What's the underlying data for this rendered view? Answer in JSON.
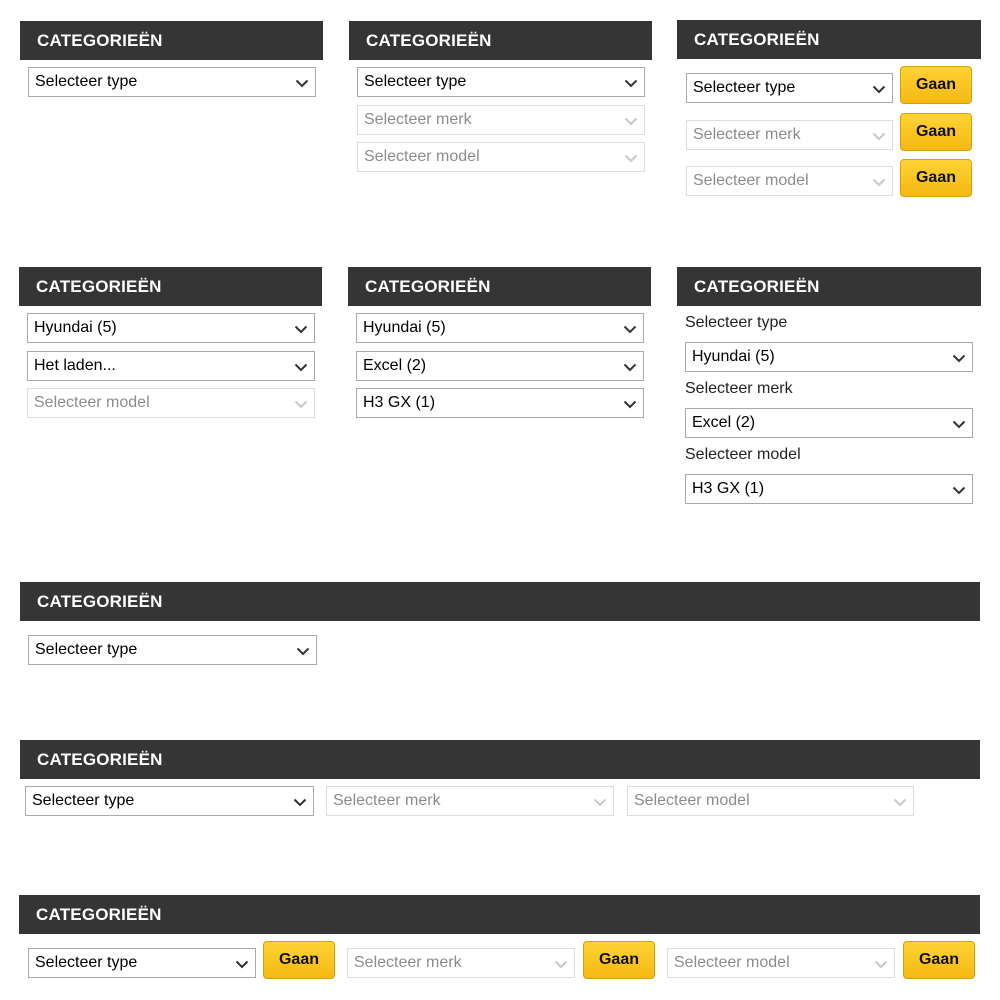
{
  "colors": {
    "header_bg": "#353535",
    "header_text": "#ffffff",
    "button_bg": "#f8c21c",
    "select_border": "#a9a9a9",
    "disabled_text": "#8c8c8c"
  },
  "icons": {
    "select_arrow": "chevron-down-icon"
  },
  "widgets": {
    "w1": {
      "header": "CATEGORIEËN",
      "type": "Selecteer type"
    },
    "w2": {
      "header": "CATEGORIEËN",
      "type": "Selecteer type",
      "merk": "Selecteer merk",
      "model": "Selecteer model"
    },
    "w3": {
      "header": "CATEGORIEËN",
      "type": "Selecteer type",
      "merk": "Selecteer merk",
      "model": "Selecteer model",
      "button": "Gaan"
    },
    "w4": {
      "header": "CATEGORIEËN",
      "type": "Hyundai (5)",
      "merk": "Het laden...",
      "model": "Selecteer model"
    },
    "w5": {
      "header": "CATEGORIEËN",
      "type": "Hyundai (5)",
      "merk": "Excel (2)",
      "model": "H3 GX (1)"
    },
    "w6": {
      "header": "CATEGORIEËN",
      "type_label": "Selecteer type",
      "type": "Hyundai (5)",
      "merk_label": "Selecteer merk",
      "merk": "Excel (2)",
      "model_label": "Selecteer model",
      "model": "H3 GX (1)"
    },
    "w7": {
      "header": "CATEGORIEËN",
      "type": "Selecteer type"
    },
    "w8": {
      "header": "CATEGORIEËN",
      "type": "Selecteer type",
      "merk": "Selecteer merk",
      "model": "Selecteer model"
    },
    "w9": {
      "header": "CATEGORIEËN",
      "type": "Selecteer type",
      "merk": "Selecteer merk",
      "model": "Selecteer model",
      "button": "Gaan"
    }
  }
}
